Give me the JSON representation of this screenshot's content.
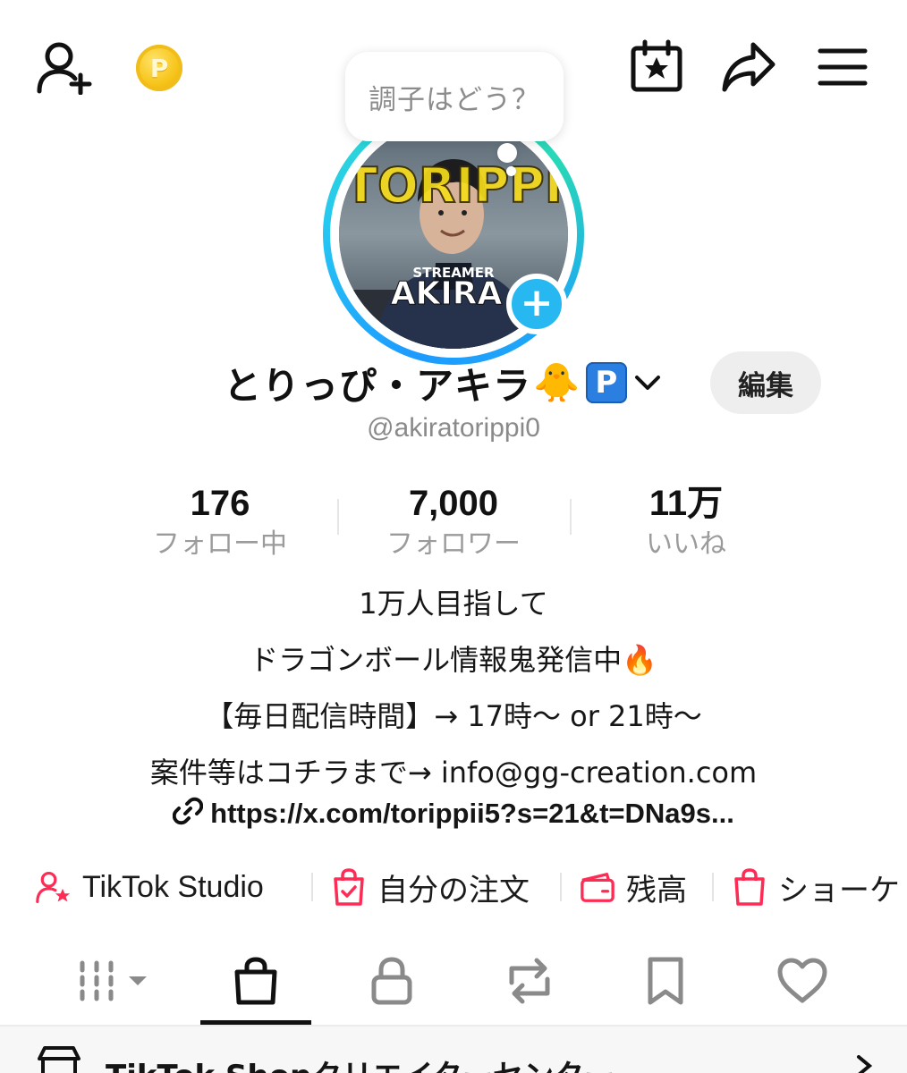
{
  "bubble_text": "調子はどう？",
  "profile": {
    "display_name": "とりっぴ・アキラ",
    "chick_emoji": "🐥",
    "p_badge": "P",
    "handle": "@akiratorippi0",
    "edit_label": "編集",
    "avatar": {
      "banner_text": "TORIPPI",
      "streamer_label": "STREAMER",
      "name_overlay": "AKIRA"
    }
  },
  "coin_letter": "P",
  "stats": [
    {
      "value": "176",
      "label": "フォロー中"
    },
    {
      "value": "7,000",
      "label": "フォロワー"
    },
    {
      "value": "11万",
      "label": "いいね"
    }
  ],
  "bio": [
    "1万人目指して",
    "ドラゴンボール情報鬼発信中🔥",
    "【毎日配信時間】→ 17時〜 or 21時〜",
    "案件等はコチラまで→ info@gg-creation.com"
  ],
  "link": "https://x.com/torippii5?s=21&t=DNa9s...",
  "tools": [
    {
      "label": "TikTok Studio",
      "icon": "person-star-icon"
    },
    {
      "label": "自分の注文",
      "icon": "order-bag-icon"
    },
    {
      "label": "残高",
      "icon": "wallet-icon"
    },
    {
      "label": "ショーケ",
      "icon": "shopping-bag-icon"
    }
  ],
  "shop_center_label": "TikTok Shopクリエイターセンター",
  "colors": {
    "accent_pink": "#fe2c55",
    "ring_blue": "#1e9bff",
    "ring_teal": "#2fe0c8",
    "coin_gold": "#f7c51b"
  }
}
